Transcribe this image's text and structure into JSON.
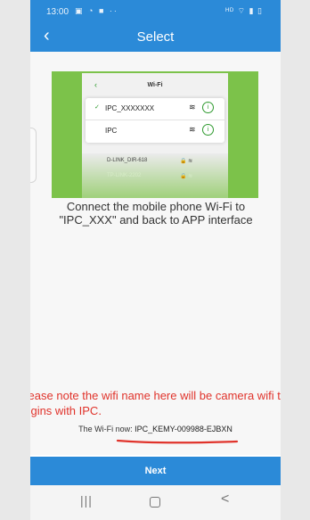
{
  "status_bar": {
    "time": "13:00",
    "left_icons": "▣ ◔ ■ ··",
    "right_icons": "ᴴᴰ ⌔ ▮ ▯"
  },
  "header": {
    "back_icon": "‹",
    "title": "Select"
  },
  "illustration": {
    "panel_title": "Wi-Fi",
    "back_glyph": "‹",
    "networks": [
      {
        "check": "✓",
        "name": "IPC_XXXXXXX",
        "signal": "≋",
        "info": "i"
      },
      {
        "check": "",
        "name": "IPC",
        "signal": "≋",
        "info": "i"
      }
    ],
    "faded_networks": [
      {
        "name": "D-LINK_DIR-618",
        "signal": "🔒 ≋"
      },
      {
        "name": "TP-LINK-2202",
        "signal": "🔒 ≋"
      }
    ]
  },
  "instructions": "Connect the mobile phone Wi-Fi to \"IPC_XXX\" and back to APP interface",
  "note": "Please note the wifi name here will be camera wifi that begins with IPC.",
  "wifi_now": {
    "label": "The Wi-Fi now: ",
    "value": "IPC_KEMY-009988-EJBXN"
  },
  "next_button": "Next",
  "navbar": {
    "recent": "|||",
    "home": "",
    "back": "<"
  },
  "colors": {
    "primary": "#2b8ad8",
    "note_red": "#e0332b",
    "illustration_green": "#7cc24a"
  }
}
